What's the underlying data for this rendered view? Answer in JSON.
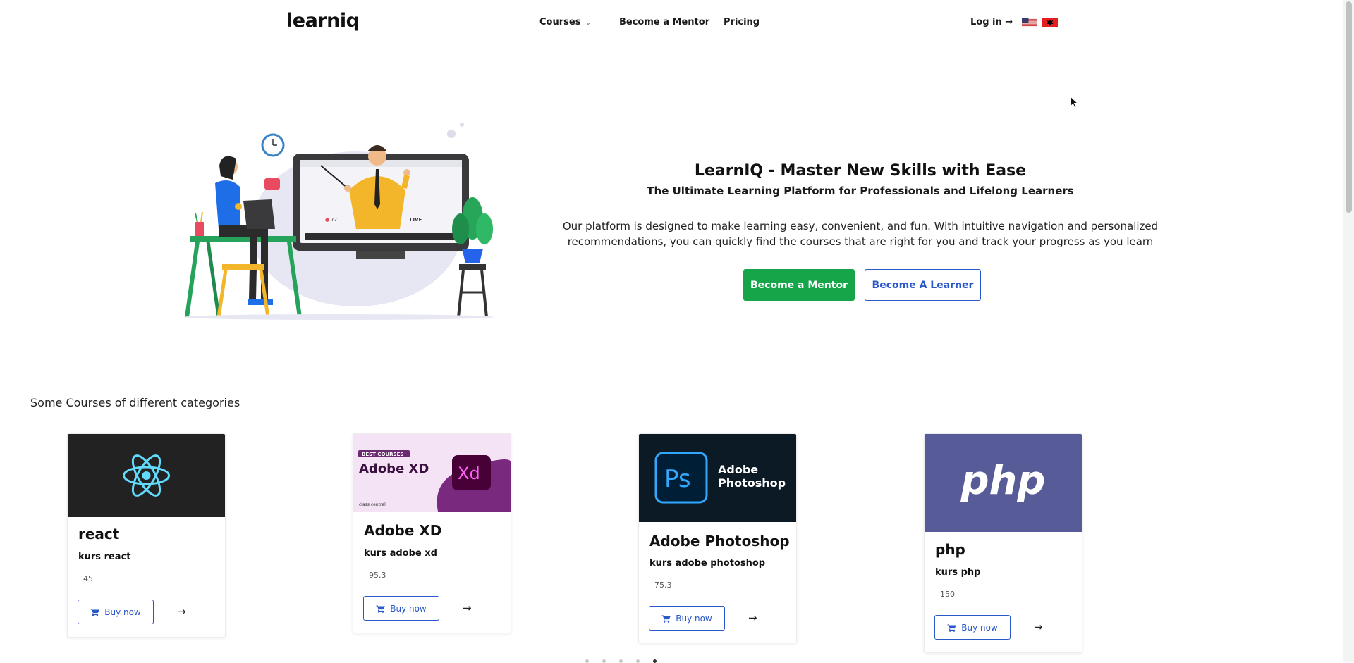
{
  "header": {
    "logo": "learniq",
    "nav": {
      "courses": "Courses",
      "become_mentor": "Become a Mentor",
      "pricing": "Pricing",
      "login": "Log in →"
    },
    "flags": [
      "us-flag-icon",
      "albania-flag-icon"
    ]
  },
  "hero": {
    "title": "LearnIQ - Master New Skills with Ease",
    "subtitle": "The Ultimate Learning Platform for Professionals and Lifelong Learners",
    "description": "Our platform is designed to make learning easy, convenient, and fun. With intuitive navigation and personalized recommendations, you can quickly find the courses that are right for you and track your progress as you learn",
    "primary_button": "Become a Mentor",
    "secondary_button": "Become A Learner",
    "illustration_labels": {
      "viewers": "72",
      "live": "LIVE"
    }
  },
  "courses_section": {
    "title": "Some Courses of different categories",
    "buy_label": "Buy now",
    "items": [
      {
        "name": "react",
        "subtitle": "kurs react",
        "price": "45",
        "image": "react-logo-icon"
      },
      {
        "name": "Adobe XD",
        "subtitle": "kurs adobe xd",
        "price": "95.3",
        "image": "adobe-xd-banner",
        "banner_badge": "BEST COURSES",
        "banner_title": "Adobe XD",
        "banner_logo": "Xd",
        "banner_footer": "class central"
      },
      {
        "name": "Adobe Photoshop",
        "subtitle": "kurs adobe photoshop",
        "price": "75.3",
        "image": "photoshop-banner",
        "banner_logo": "Ps",
        "banner_title_1": "Adobe",
        "banner_title_2": "Photoshop"
      },
      {
        "name": "php",
        "subtitle": "kurs php",
        "price": "150",
        "image": "php-logo",
        "banner_logo": "php"
      }
    ],
    "carousel_dots": 5,
    "active_dot": 5
  },
  "colors": {
    "primary_green": "#17a54a",
    "primary_blue": "#2a58c9",
    "react_bg": "#222222",
    "react_accent": "#61dafb",
    "xd_bg": "#f3e3f5",
    "ps_bg": "#0b1a24",
    "ps_accent": "#31a8ff",
    "php_bg": "#575b98"
  }
}
